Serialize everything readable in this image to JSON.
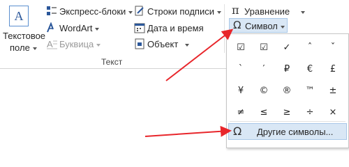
{
  "ribbon": {
    "text_box": {
      "line1": "Текстовое",
      "line2": "поле"
    },
    "express_blocks": "Экспресс-блоки",
    "wordart": "WordArt",
    "dropcap": "Буквица",
    "signature_line": "Строки подписи",
    "date_time": "Дата и время",
    "object": "Объект",
    "group_text_label": "Текст",
    "equation": "Уравнение",
    "symbol": "Символ"
  },
  "symbols_menu": {
    "grid": [
      "☑",
      "☑",
      "✓",
      "ˆ",
      "ˇ",
      "`",
      "′",
      "₽",
      "€",
      "£",
      "¥",
      "©",
      "®",
      "™",
      "±",
      "≠",
      "≤",
      "≥",
      "÷",
      "×"
    ],
    "more_symbols": "Другие символы...",
    "omega": "Ω"
  },
  "colors": {
    "accent_blue": "#2b579a",
    "highlight": "#d9e7f5",
    "arrow_red": "#e8262b"
  },
  "icons": {
    "text_box": "text-box-icon",
    "express_blocks": "quick-parts-icon",
    "wordart": "wordart-icon",
    "dropcap": "dropcap-icon",
    "signature": "signature-line-icon",
    "date_time": "calendar-icon",
    "object": "object-icon",
    "equation": "pi-icon",
    "symbol": "omega-icon"
  }
}
